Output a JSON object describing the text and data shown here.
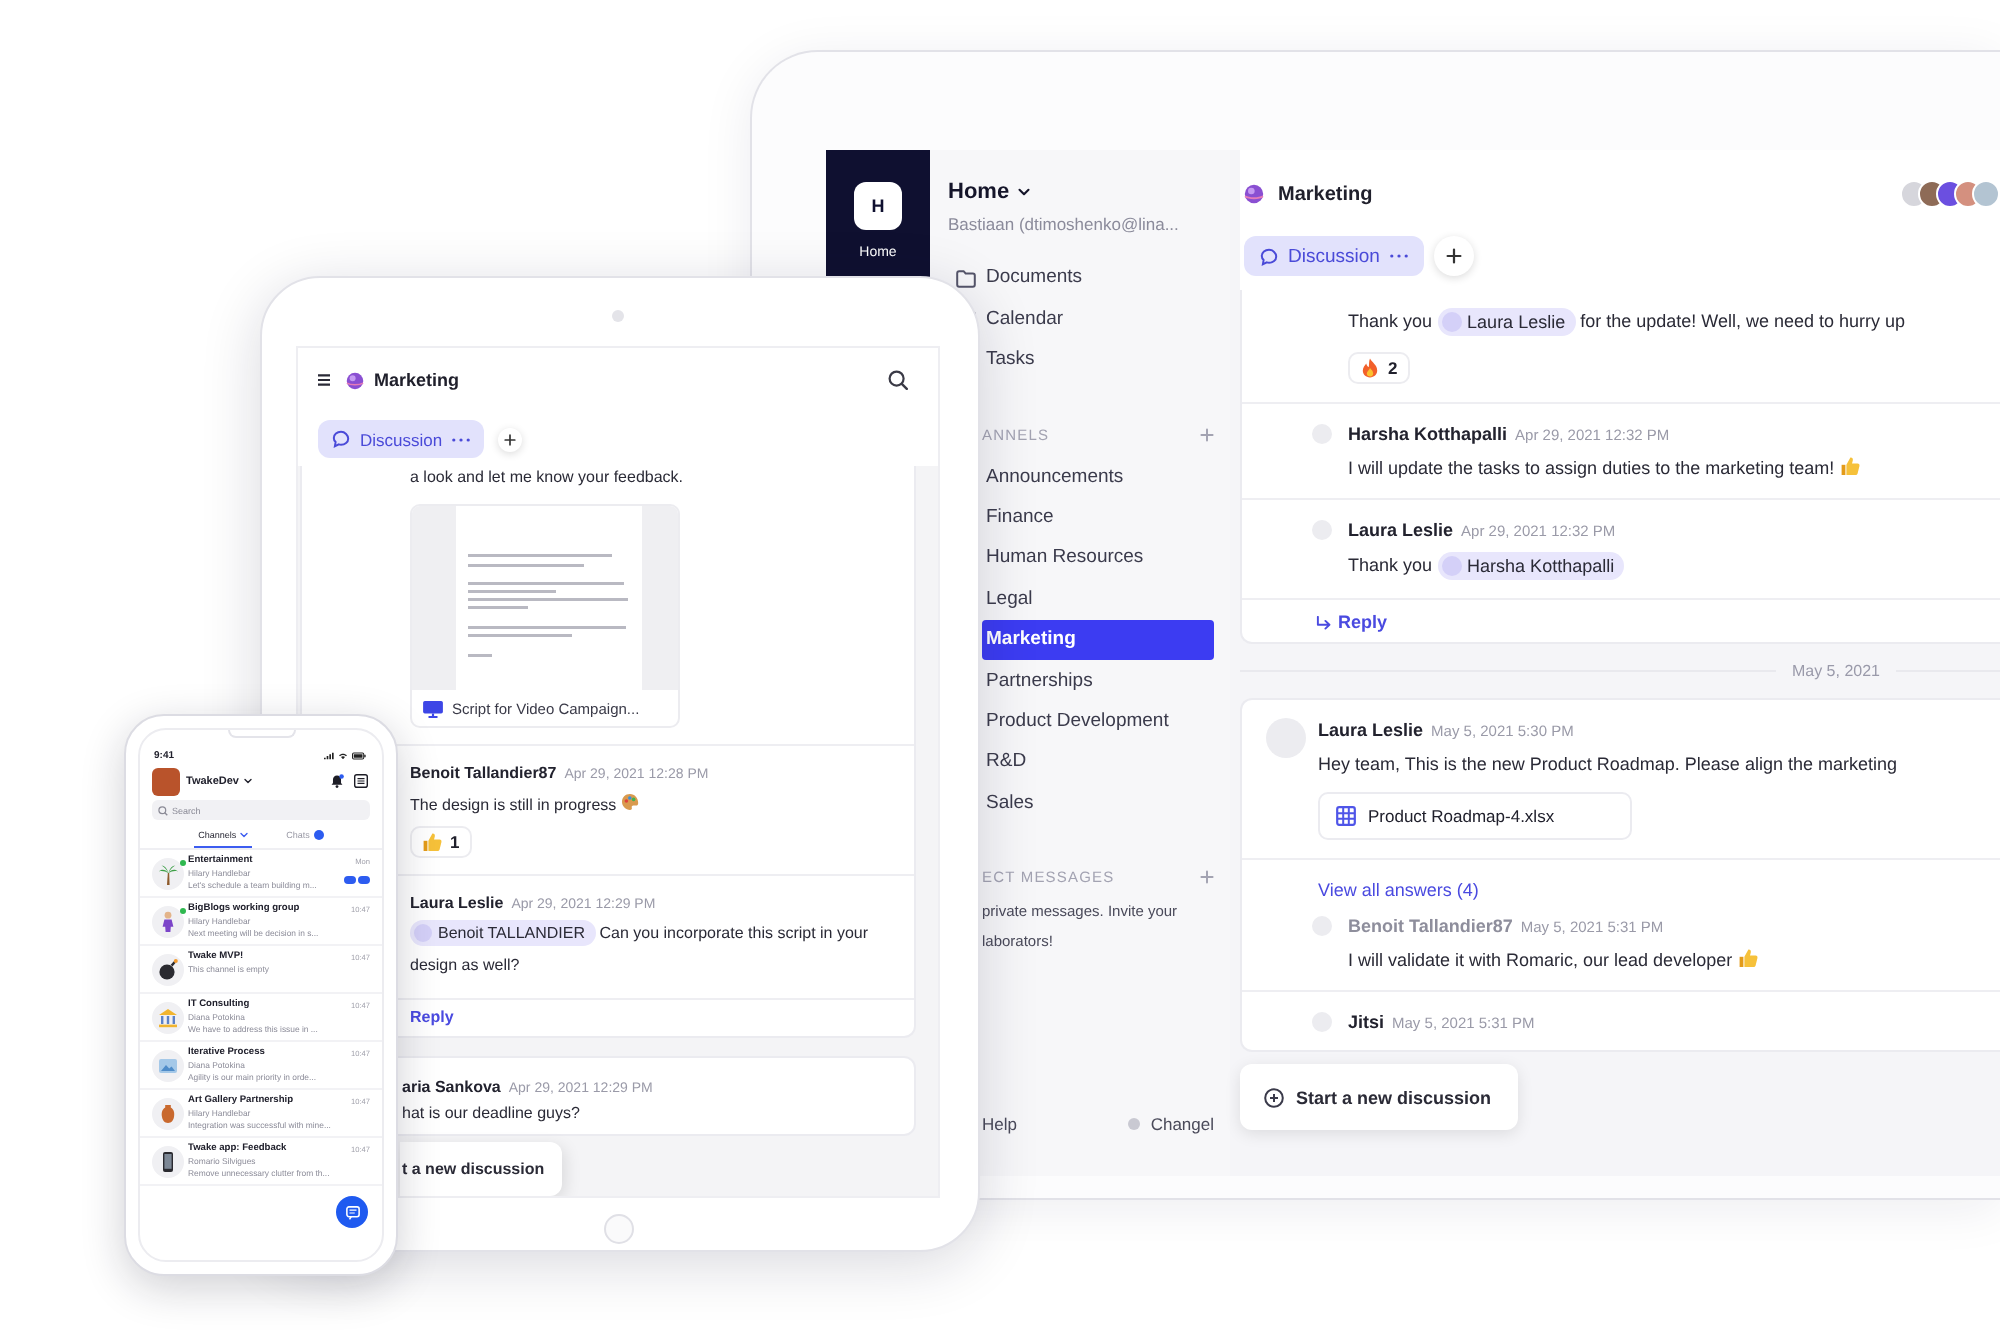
{
  "laptop": {
    "rail": {
      "initial": "H",
      "label": "Home"
    },
    "sidebar": {
      "workspace": "Home",
      "user": "Bastiaan (dtimoshenko@lina...",
      "nav": [
        {
          "label": "Documents",
          "kind": "folder"
        },
        {
          "label": "Calendar",
          "kind": "calendar"
        },
        {
          "label": "Tasks"
        }
      ],
      "channels_header": "ANNELS",
      "channels": [
        {
          "label": "Announcements",
          "selected": false
        },
        {
          "label": "Finance",
          "selected": false
        },
        {
          "label": "Human Resources",
          "selected": false
        },
        {
          "label": "Legal",
          "selected": false
        },
        {
          "label": "Marketing",
          "selected": true
        },
        {
          "label": "Partnerships",
          "selected": false
        },
        {
          "label": "Product Development",
          "selected": false
        },
        {
          "label": "R&D",
          "selected": false
        },
        {
          "label": "Sales",
          "selected": false
        }
      ],
      "messages_header": "ECT MESSAGES",
      "messages_empty": [
        "private messages. Invite your",
        "laborators!"
      ],
      "help": "Help",
      "changelog": "Changel"
    },
    "channel": {
      "name": "Marketing",
      "tabs": [
        {
          "label": "Discussion",
          "selected": true
        }
      ]
    },
    "threads": [
      {
        "replies": [
          {
            "parts": [
              {
                "kind": "text",
                "text": "Thank you"
              },
              {
                "kind": "mention",
                "text": "Laura Leslie"
              },
              {
                "kind": "text",
                "text": "for the update! Well, we need to hurry up"
              }
            ],
            "reaction": {
              "kind": "fire",
              "count": "2"
            }
          },
          {
            "author": "Harsha Kotthapalli",
            "author_muted": false,
            "time": "Apr 29, 2021 12:32 PM",
            "parts": [
              {
                "kind": "text",
                "text": "I will update the tasks to assign duties to the marketing team!"
              },
              {
                "kind": "thumbs-up"
              }
            ]
          },
          {
            "author": "Laura Leslie",
            "author_muted": false,
            "time": "Apr 29, 2021 12:32 PM",
            "parts": [
              {
                "kind": "text",
                "text": "Thank you"
              },
              {
                "kind": "mention",
                "text": "Harsha Kotthapalli"
              }
            ]
          }
        ],
        "reply": "Reply"
      },
      {
        "date": "May 5, 2021",
        "root": {
          "author": "Laura Leslie",
          "author_muted": false,
          "time": "May 5, 2021 5:30 PM",
          "parts": [
            {
              "kind": "text",
              "text": "Hey team, This is the new Product Roadmap. Please align the marketing"
            }
          ],
          "attachment": {
            "kind": "sheet",
            "name": "Product Roadmap-4.xlsx"
          }
        },
        "view_all": "View all answers (4)",
        "replies": [
          {
            "author": "Benoit Tallandier87",
            "author_muted": true,
            "time": "May 5, 2021 5:31 PM",
            "parts": [
              {
                "kind": "text",
                "text": "I will validate it with Romaric, our lead developer"
              },
              {
                "kind": "thumbs-up"
              }
            ]
          },
          {
            "author": "Jitsi",
            "author_muted": false,
            "time": "May 5, 2021 5:31 PM"
          }
        ]
      }
    ],
    "new_discussion": "Start a new discussion"
  },
  "tablet": {
    "channel": "Marketing",
    "tabs": [
      {
        "label": "Discussion",
        "selected": true
      }
    ],
    "threads": [
      {
        "replies": [
          {
            "parts": [
              {
                "kind": "text",
                "text": "a look and let me know your feedback."
              }
            ],
            "attachment": {
              "kind": "slides",
              "name": "Script for Video Campaign..."
            }
          },
          {
            "author": "Benoit Tallandier87",
            "author_muted": false,
            "time": "Apr 29, 2021 12:28 PM",
            "parts": [
              {
                "kind": "text",
                "text": "The design is still in progress"
              },
              {
                "kind": "palette"
              }
            ],
            "reaction": {
              "kind": "thumbs-up",
              "count": "1"
            }
          },
          {
            "author": "Laura Leslie",
            "author_muted": false,
            "time": "Apr 29, 2021 12:29 PM",
            "parts": [
              {
                "kind": "mention",
                "text": "Benoit TALLANDIER"
              },
              {
                "kind": "text",
                "text": "Can you incorporate this script in your design as well?"
              }
            ]
          }
        ],
        "reply": "Reply"
      },
      {
        "root": {
          "author": "aria Sankova",
          "author_muted": false,
          "time": "Apr 29, 2021 12:29 PM",
          "parts": [
            {
              "kind": "text",
              "text": "hat is our deadline guys?"
            }
          ]
        }
      }
    ],
    "new_discussion": "t a new discussion"
  },
  "phone": {
    "time": "9:41",
    "workspace": "TwakeDev",
    "search": {
      "placeholder": "Search"
    },
    "tabs": [
      {
        "label": "Channels",
        "selected": true,
        "unread": false
      },
      {
        "label": "Chats",
        "selected": false,
        "unread": true
      }
    ],
    "channels": [
      {
        "kind": "palm",
        "name": "Entertainment",
        "online": true,
        "author": "Hilary Handlebar",
        "preview": "Let's schedule a team building m...",
        "time": "Mon",
        "unread": true
      },
      {
        "kind": "person",
        "name": "BigBlogs working group",
        "online": true,
        "author": "Hilary Handlebar",
        "preview": "Next meeting will be decision in s...",
        "time": "10:47",
        "unread": false
      },
      {
        "kind": "bomb",
        "name": "Twake MVP!",
        "online": false,
        "preview": "This channel is empty",
        "time": "10:47",
        "unread": false
      },
      {
        "kind": "bank",
        "name": "IT Consulting",
        "online": false,
        "author": "Diana Potokina",
        "preview": "We have to address this issue in ...",
        "time": "10:47",
        "unread": false
      },
      {
        "kind": "picture",
        "name": "Iterative Process",
        "online": false,
        "author": "Diana Potokina",
        "preview": "Agility is our main priority in orde...",
        "time": "10:47",
        "unread": false
      },
      {
        "kind": "vase",
        "name": "Art Gallery Partnership",
        "online": false,
        "author": "Hilary Handlebar",
        "preview": "Integration was successful with mine...",
        "time": "10:47",
        "unread": false
      },
      {
        "kind": "phone",
        "name": "Twake app: Feedback",
        "online": false,
        "author": "Romario Silvigues",
        "preview": "Remove unnecessary clutter from th...",
        "time": "10:47",
        "unread": false
      }
    ]
  }
}
